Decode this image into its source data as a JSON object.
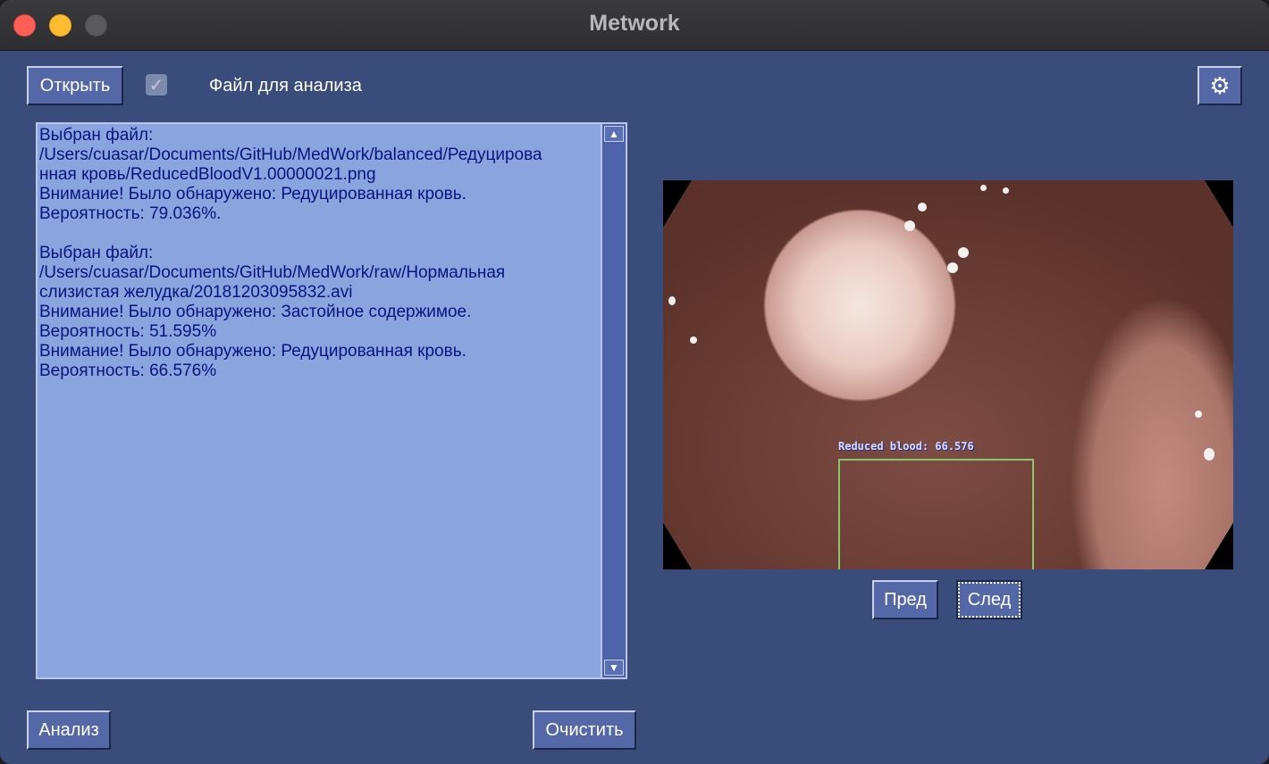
{
  "window": {
    "title": "Metwork"
  },
  "toolbar": {
    "open_label": "Открыть",
    "file_label": "Файл для анализа",
    "settings_icon": "gear-icon",
    "checkbox_checked": true
  },
  "log": {
    "text": "Выбран файл:\n/Users/cuasar/Documents/GitHub/MedWork/balanced/Редуцирова\nнная кровь/ReducedBloodV1.00000021.png\nВнимание! Было обнаружено: Редуцированная кровь.\nВероятность: 79.036%.\n\nВыбран файл:\n/Users/cuasar/Documents/GitHub/MedWork/raw/Нормальная\nслизистая желудка/20181203095832.avi\nВнимание! Было обнаружено: Застойное содержимое.\nВероятность: 51.595%\nВнимание! Было обнаружено: Редуцированная кровь.\nВероятность: 66.576%"
  },
  "viewer": {
    "detection_label": "Reduced blood: 66.576",
    "prev_label": "Пред",
    "next_label": "След"
  },
  "footer": {
    "analyze_label": "Анализ",
    "clear_label": "Очистить"
  }
}
